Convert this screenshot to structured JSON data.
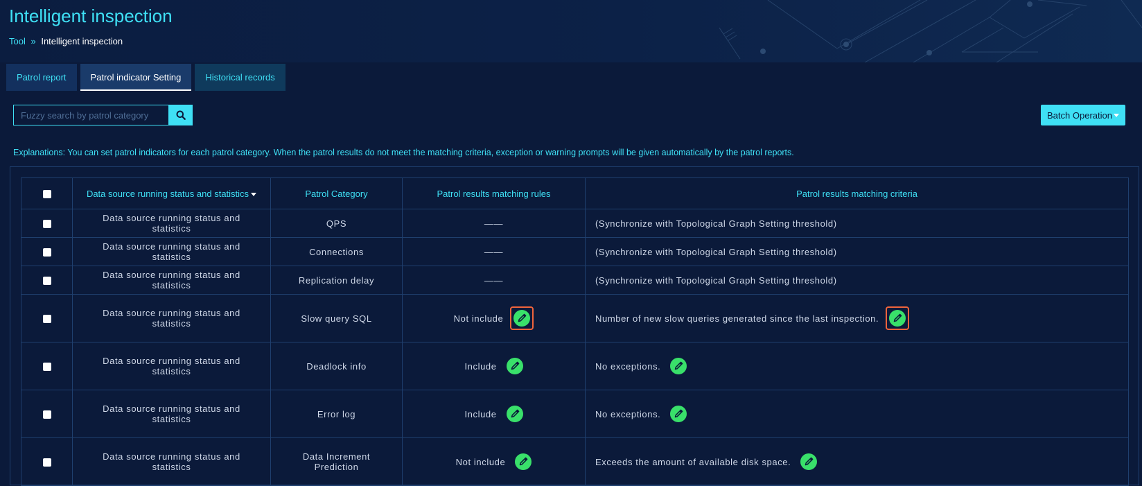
{
  "page": {
    "title": "Intelligent inspection"
  },
  "breadcrumb": {
    "parent": "Tool",
    "current": "Intelligent inspection"
  },
  "tabs": [
    {
      "label": "Patrol report"
    },
    {
      "label": "Patrol indicator Setting",
      "active": true
    },
    {
      "label": "Historical records"
    }
  ],
  "search": {
    "placeholder": "Fuzzy search by patrol category",
    "value": ""
  },
  "toolbar": {
    "batch_label": "Batch Operation"
  },
  "explanation": "Explanations: You can set patrol indicators for each patrol category. When the patrol results do not meet the matching criteria, exception or warning prompts will be given automatically by the patrol reports.",
  "table": {
    "headers": {
      "source": "Data source running status and statistics",
      "category": "Patrol Category",
      "rules": "Patrol results matching rules",
      "criteria": "Patrol results matching criteria"
    },
    "rows": [
      {
        "source": "Data source running status and statistics",
        "category": "QPS",
        "rules": "——",
        "criteria": "(Synchronize with Topological Graph Setting threshold)"
      },
      {
        "source": "Data source running status and statistics",
        "category": "Connections",
        "rules": "——",
        "criteria": "(Synchronize with Topological Graph Setting threshold)"
      },
      {
        "source": "Data source running status and statistics",
        "category": "Replication delay",
        "rules": "——",
        "criteria": "(Synchronize with Topological Graph Setting threshold)"
      },
      {
        "source": "Data source running status and statistics",
        "category": "Slow query SQL",
        "rules": "Not include",
        "criteria": "Number of new slow queries generated since the last inspection."
      },
      {
        "source": "Data source running status and statistics",
        "category": "Deadlock info",
        "rules": "Include",
        "criteria": "No exceptions."
      },
      {
        "source": "Data source running status and statistics",
        "category": "Error log",
        "rules": "Include",
        "criteria": "No exceptions."
      },
      {
        "source": "Data source running status and statistics",
        "category": "Data Increment Prediction",
        "rules": "Not include",
        "criteria": "Exceeds the amount of available disk space."
      }
    ]
  },
  "colors": {
    "accent": "#3fe0f5",
    "background": "#0b1a3a",
    "edit": "#39e06a",
    "highlight": "#f0643c"
  },
  "icons": {
    "search": "search-icon",
    "edit": "pencil-icon",
    "sort": "caret-down-icon"
  }
}
